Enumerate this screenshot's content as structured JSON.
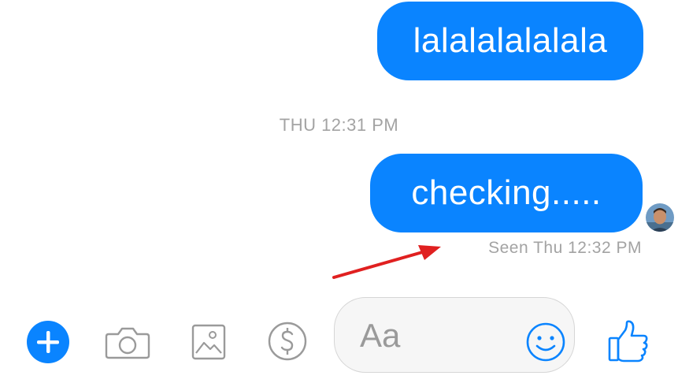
{
  "messages": [
    {
      "text": "lalalalalalala",
      "sender": "me"
    },
    {
      "text": "checking.....",
      "sender": "me"
    }
  ],
  "timestamp": "THU 12:31 PM",
  "seen_status": "Seen Thu 12:32 PM",
  "composer": {
    "placeholder": "Aa",
    "value": ""
  },
  "toolbar": {
    "icons": [
      "plus-icon",
      "camera-icon",
      "image-icon",
      "dollar-icon",
      "smiley-icon",
      "thumbs-up-icon"
    ]
  },
  "colors": {
    "accent": "#0a84ff",
    "annotation_arrow": "#e02020",
    "muted_text": "#a3a3a3"
  }
}
